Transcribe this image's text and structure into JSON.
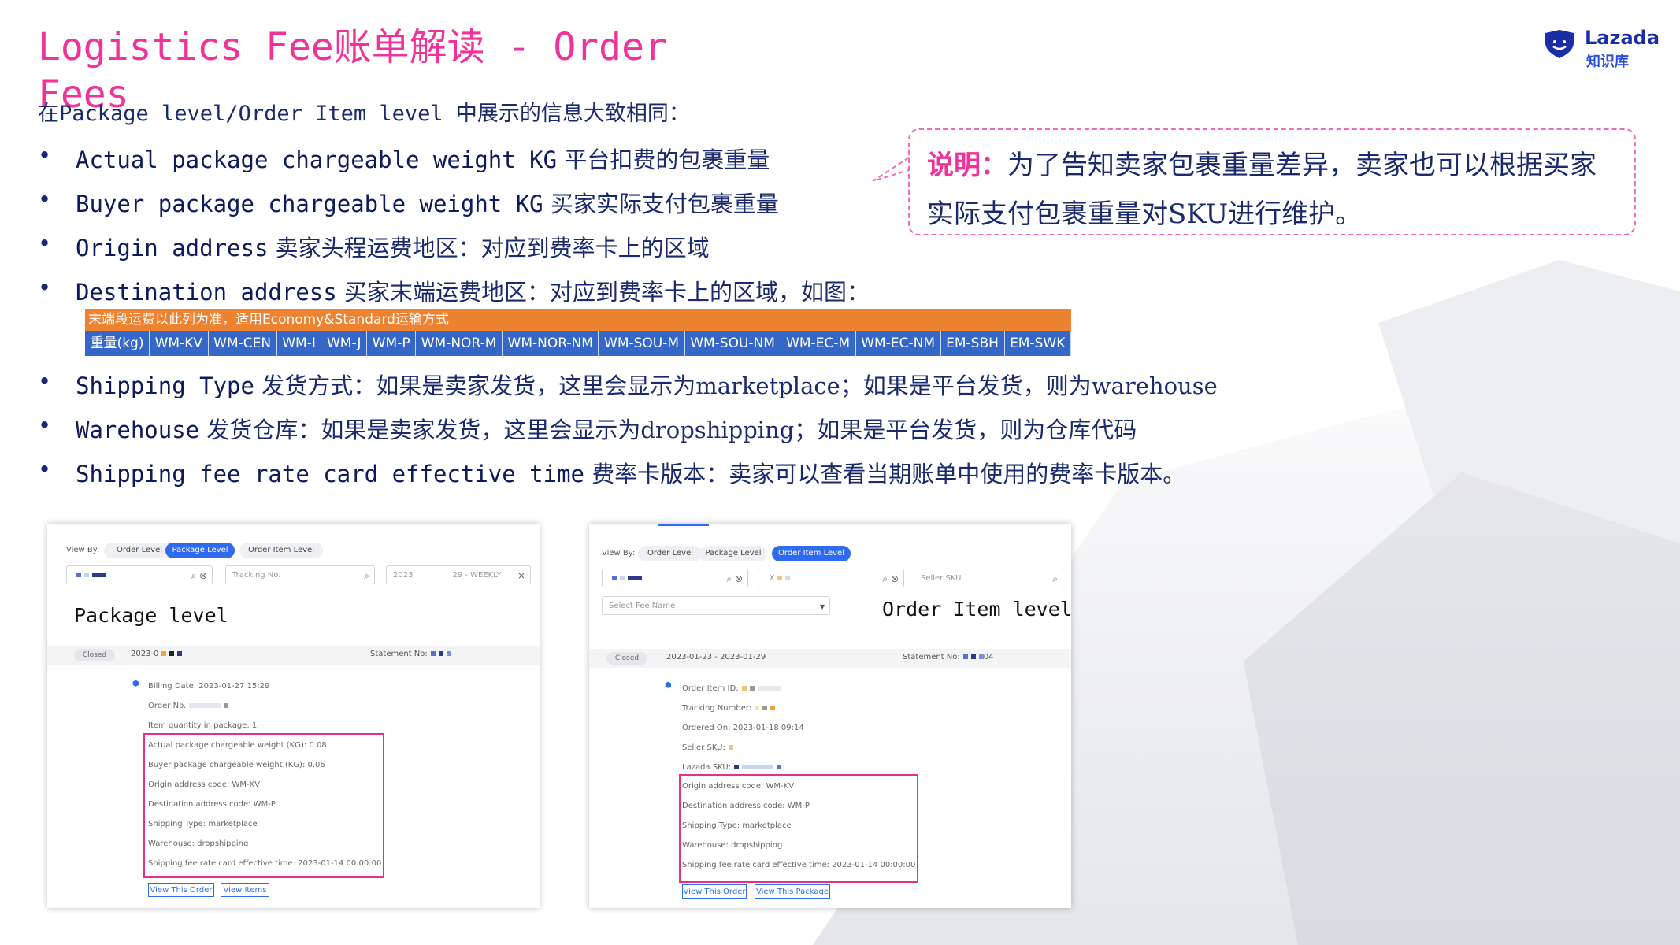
{
  "title": "Logistics Fee账单解读 - Order Fees",
  "logo": {
    "brand": "Lazada",
    "sub": "知识库",
    "icon": "lazada-heart-icon"
  },
  "intro": "在Package level/Order Item level 中展示的信息大致相同：",
  "bullets": [
    {
      "en": "Actual package chargeable weight KG",
      "cn": "平台扣费的包裹重量"
    },
    {
      "en": "Buyer package chargeable weight KG",
      "cn": "买家实际支付包裹重量"
    },
    {
      "en": "Origin address",
      "cn": "卖家头程运费地区：对应到费率卡上的区域"
    },
    {
      "en": "Destination address",
      "cn": "买家末端运费地区：对应到费率卡上的区域，如图："
    },
    {
      "en": "Shipping Type",
      "cn": "发货方式：如果是卖家发货，这里会显示为marketplace；如果是平台发货，则为warehouse"
    },
    {
      "en": "Warehouse",
      "cn": "发货仓库：如果是卖家发货，这里会显示为dropshipping；如果是平台发货，则为仓库代码"
    },
    {
      "en": "Shipping fee rate card effective time",
      "cn": "费率卡版本：卖家可以查看当期账单中使用的费率卡版本。"
    }
  ],
  "note": {
    "label": "说明：",
    "text": "为了告知卖家包裹重量差异，卖家也可以根据买家实际支付包裹重量对SKU进行维护。"
  },
  "rate_table": {
    "header": "末端段运费以此列为准，适用Economy&Standard运输方式",
    "columns": [
      "重量(kg)",
      "WM-KV",
      "WM-CEN",
      "WM-I",
      "WM-J",
      "WM-P",
      "WM-NOR-M",
      "WM-NOR-NM",
      "WM-SOU-M",
      "WM-SOU-NM",
      "WM-EC-M",
      "WM-EC-NM",
      "EM-SBH",
      "EM-SWK"
    ]
  },
  "panelA": {
    "view_by": "View By:",
    "tabs": [
      "Order Level",
      "Package Level",
      "Order Item Level"
    ],
    "active_tab": 1,
    "tracking_placeholder": "Tracking No.",
    "period_start": "2023",
    "period_end": "29 - WEEKLY",
    "caption": "Package level",
    "status": "Closed",
    "period": "2023-0",
    "statement_label": "Statement No:",
    "billing_date": "Billing Date:  2023-01-27 15:29",
    "order_no": "Order No.",
    "item_qty": "Item quantity in package:  1",
    "fields": [
      "Actual package chargeable weight (KG):  0.08",
      "Buyer package chargeable weight (KG):  0.06",
      "Origin address code:  WM-KV",
      "Destination address code:  WM-P",
      "Shipping Type:  marketplace",
      "Warehouse:  dropshipping",
      "Shipping fee rate card effective time:  2023-01-14 00:00:00"
    ],
    "buttons": [
      "View This Order",
      "View Items"
    ]
  },
  "panelB": {
    "view_by": "View By:",
    "tabs": [
      "Order Level",
      "Package Level",
      "Order Item Level"
    ],
    "active_tab": 2,
    "search_value": "LX",
    "seller_sku_placeholder": "Seller SKU",
    "fee_name_placeholder": "Select Fee Name",
    "caption": "Order Item level",
    "status": "Closed",
    "period": "2023-01-23 - 2023-01-29",
    "statement_label": "Statement No:",
    "statement_suffix": "04",
    "info": [
      "Order Item ID:",
      "Tracking Number:",
      "Ordered On:  2023-01-18 09:14",
      "Seller SKU:",
      "Lazada SKU:"
    ],
    "fields": [
      "Origin address code:  WM-KV",
      "Destination address code:  WM-P",
      "Shipping Type:  marketplace",
      "Warehouse:  dropshipping",
      "Shipping fee rate card effective time:  2023-01-14 00:00:00"
    ],
    "buttons": [
      "View This Order",
      "View This Package"
    ]
  },
  "colors": {
    "title": "#f0339a",
    "text": "#1a2a6c",
    "highlight": "#e5308a",
    "rate_header": "#ed8331",
    "rate_row": "#3467c7",
    "active_pill": "#2f6bf0"
  }
}
